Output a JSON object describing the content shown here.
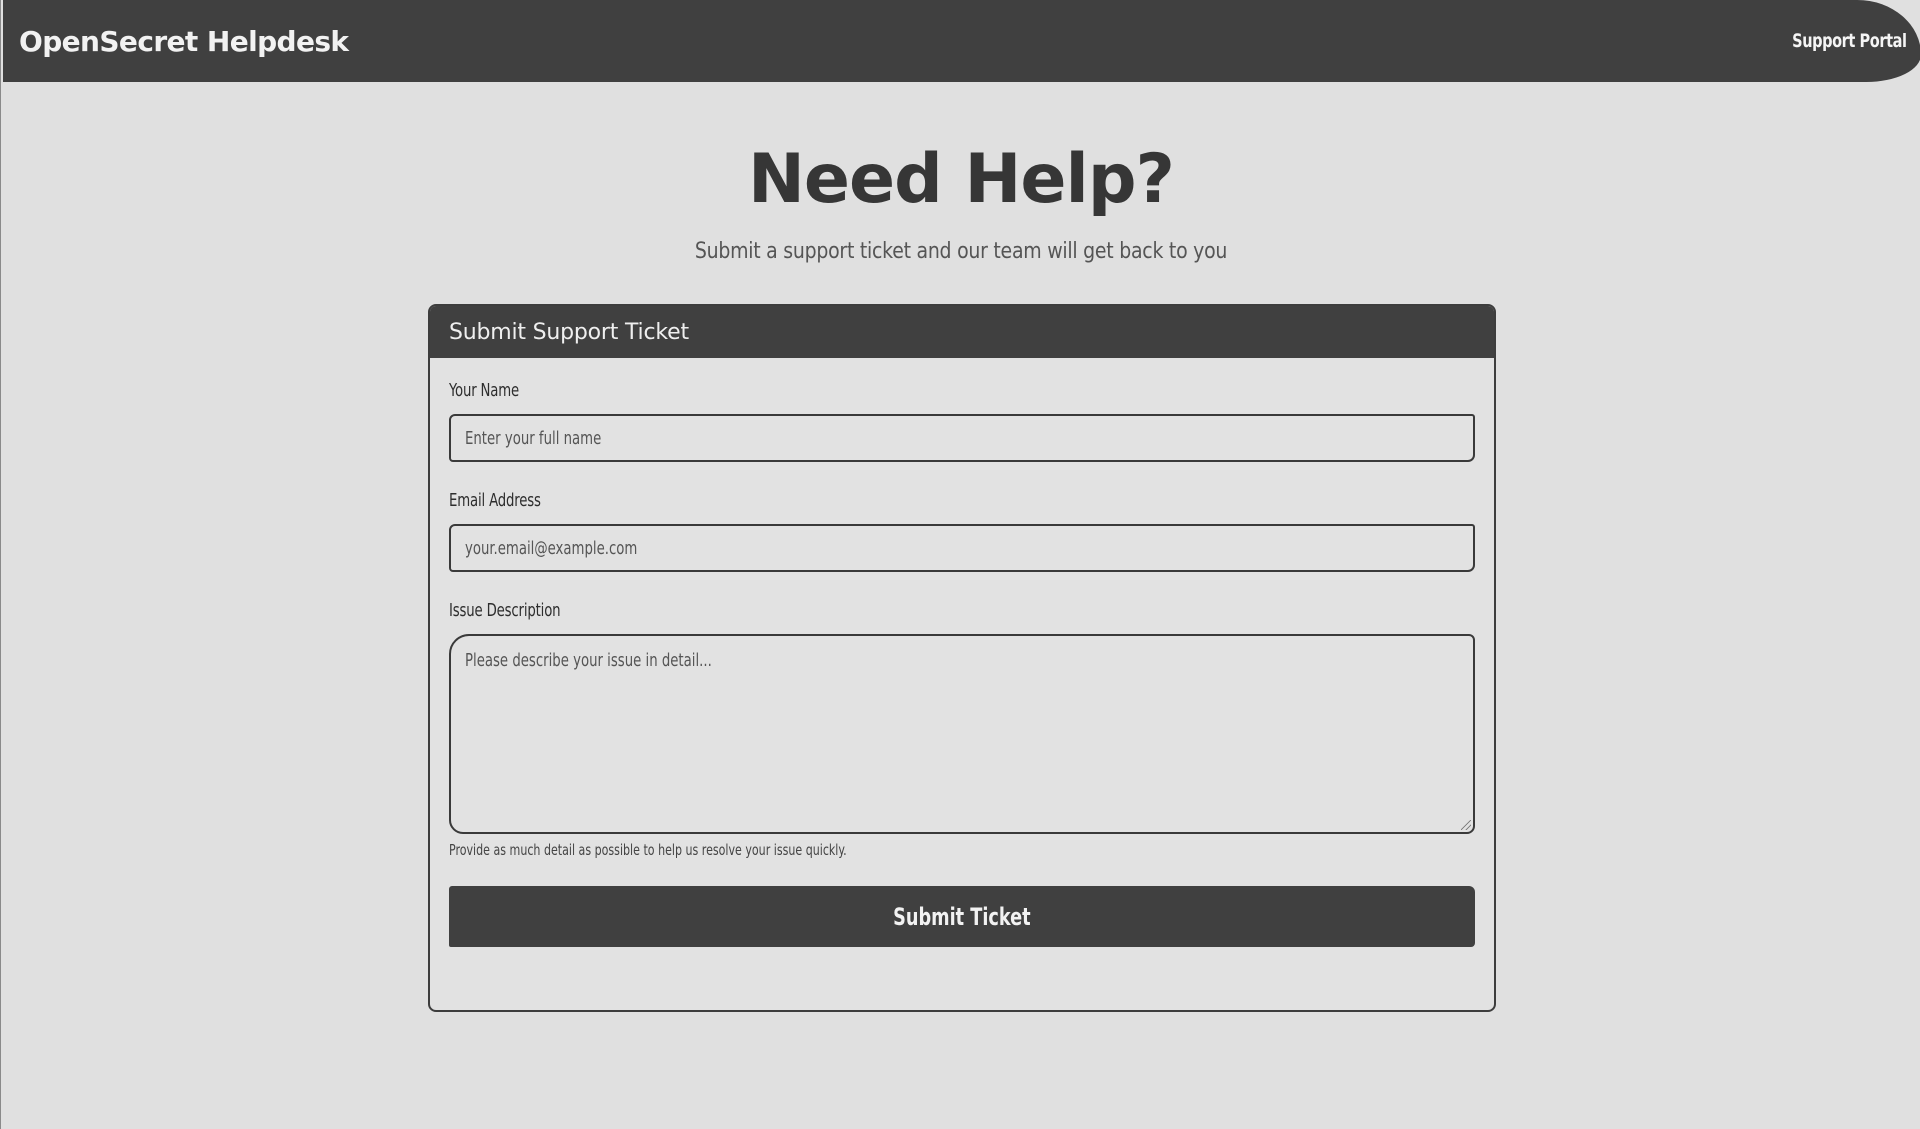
{
  "navbar": {
    "brand": "OpenSecret Helpdesk",
    "link": "Support Portal"
  },
  "hero": {
    "title": "Need Help?",
    "subtitle": "Submit a support ticket and our team will get back to you"
  },
  "form": {
    "header": "Submit Support Ticket",
    "name_label": "Your Name",
    "name_placeholder": "Enter your full name",
    "email_label": "Email Address",
    "email_placeholder": "your.email@example.com",
    "description_label": "Issue Description",
    "description_placeholder": "Please describe your issue in detail...",
    "help_text": "Provide as much detail as possible to help us resolve your issue quickly.",
    "submit_label": "Submit Ticket"
  },
  "colors": {
    "navbar_bg": "#404040",
    "page_bg": "#e0e0e0",
    "button_bg": "#404040"
  }
}
